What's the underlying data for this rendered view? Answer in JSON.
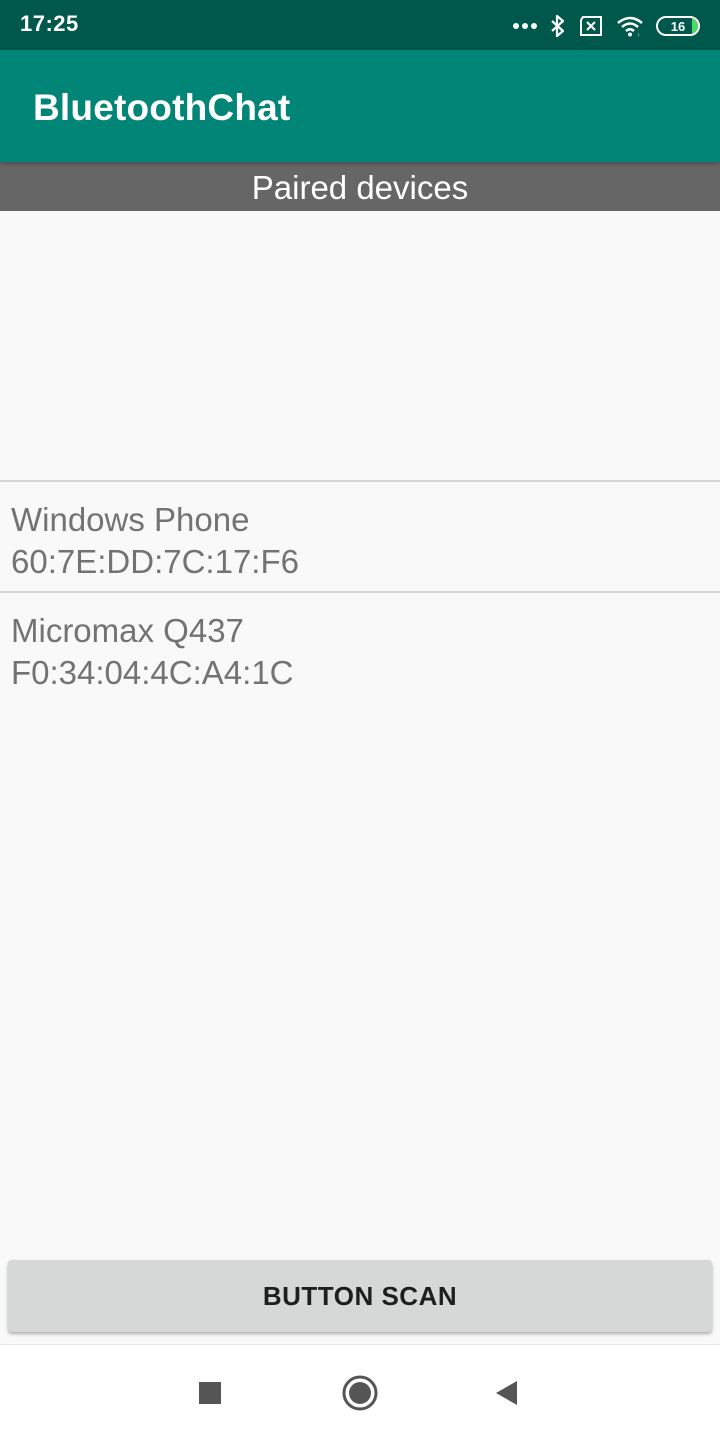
{
  "status_bar": {
    "time": "17:25",
    "battery_level": "16",
    "icons": [
      "more-dots-icon",
      "bluetooth-icon",
      "sim-off-icon",
      "wifi-icon",
      "battery-icon"
    ]
  },
  "app_bar": {
    "title": "BluetoothChat"
  },
  "paired_section": {
    "header": "Paired devices"
  },
  "devices": [
    {
      "name": "Windows Phone",
      "address": "60:7E:DD:7C:17:F6"
    },
    {
      "name": "Micromax Q437",
      "address": "F0:34:04:4C:A4:1C"
    }
  ],
  "scan_button": {
    "label": "BUTTON SCAN"
  },
  "nav_bar": {
    "icons": [
      "recent-apps-icon",
      "home-icon",
      "back-icon"
    ]
  },
  "colors": {
    "status_bar": "#00574b",
    "app_bar": "#008577",
    "section_header": "#666666",
    "list_text": "#737373",
    "button_bg": "#d6d7d7"
  }
}
